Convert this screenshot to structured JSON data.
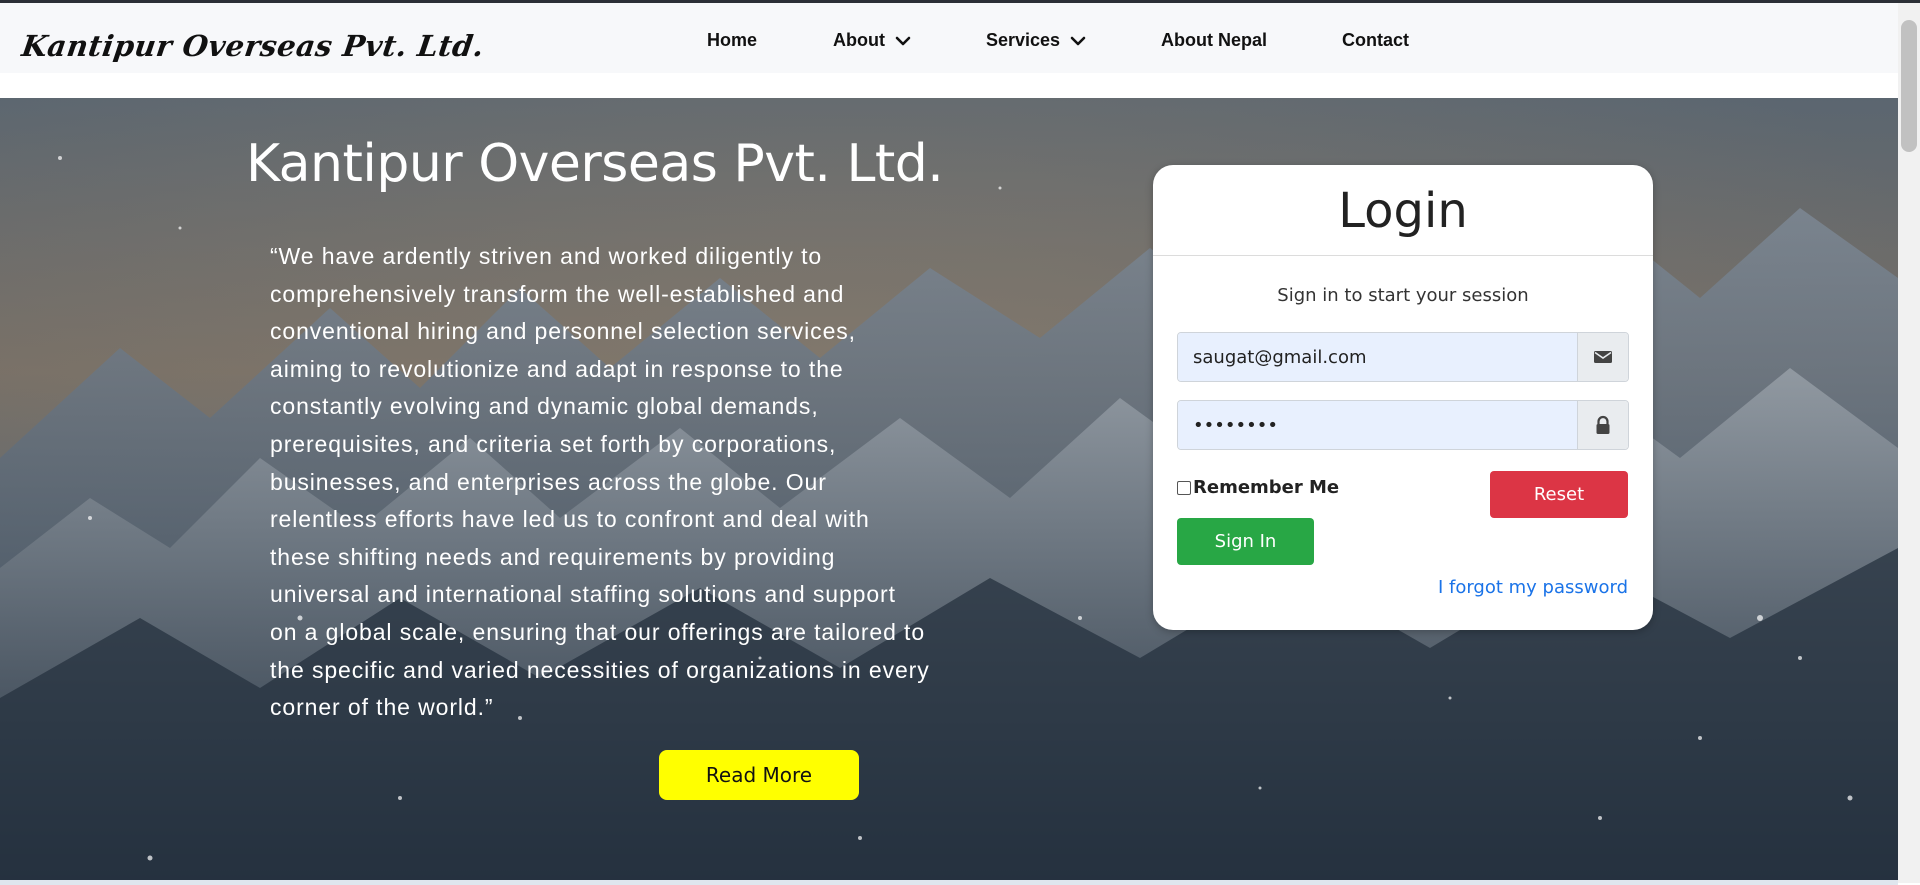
{
  "navbar": {
    "brand": "Kantipur Overseas Pvt. Ltd.",
    "items": [
      {
        "label": "Home"
      },
      {
        "label": "About"
      },
      {
        "label": "Services"
      },
      {
        "label": "About Nepal"
      },
      {
        "label": "Contact"
      }
    ]
  },
  "hero": {
    "title": "Kantipur Overseas Pvt. Ltd.",
    "quote": "“We have ardently striven and worked diligently to comprehensively transform the well-established and conventional hiring and personnel selection services, aiming to revolutionize and adapt in response to the constantly evolving and dynamic global demands, prerequisites, and criteria set forth by corporations, businesses, and enterprises across the globe. Our relentless efforts have led us to confront and deal with these shifting needs and requirements by providing universal and international staffing solutions and support on a global scale, ensuring that our offerings are tailored to the specific and varied necessities of organizations in every corner of the world.”",
    "read_more": "Read More"
  },
  "login": {
    "title": "Login",
    "message": "Sign in to start your session",
    "email_value": "saugat@gmail.com",
    "password_value": "••••••••",
    "remember_label": "Remember Me",
    "reset_label": "Reset",
    "signin_label": "Sign In",
    "forgot_label": "I forgot my password"
  },
  "icons": {
    "dropdown": "chevron-down-icon",
    "email": "envelope-icon",
    "password": "lock-icon"
  },
  "colors": {
    "read_more_bg": "#ffff00",
    "reset_bg": "#dc3545",
    "signin_bg": "#28a745",
    "link": "#1a73e8"
  }
}
